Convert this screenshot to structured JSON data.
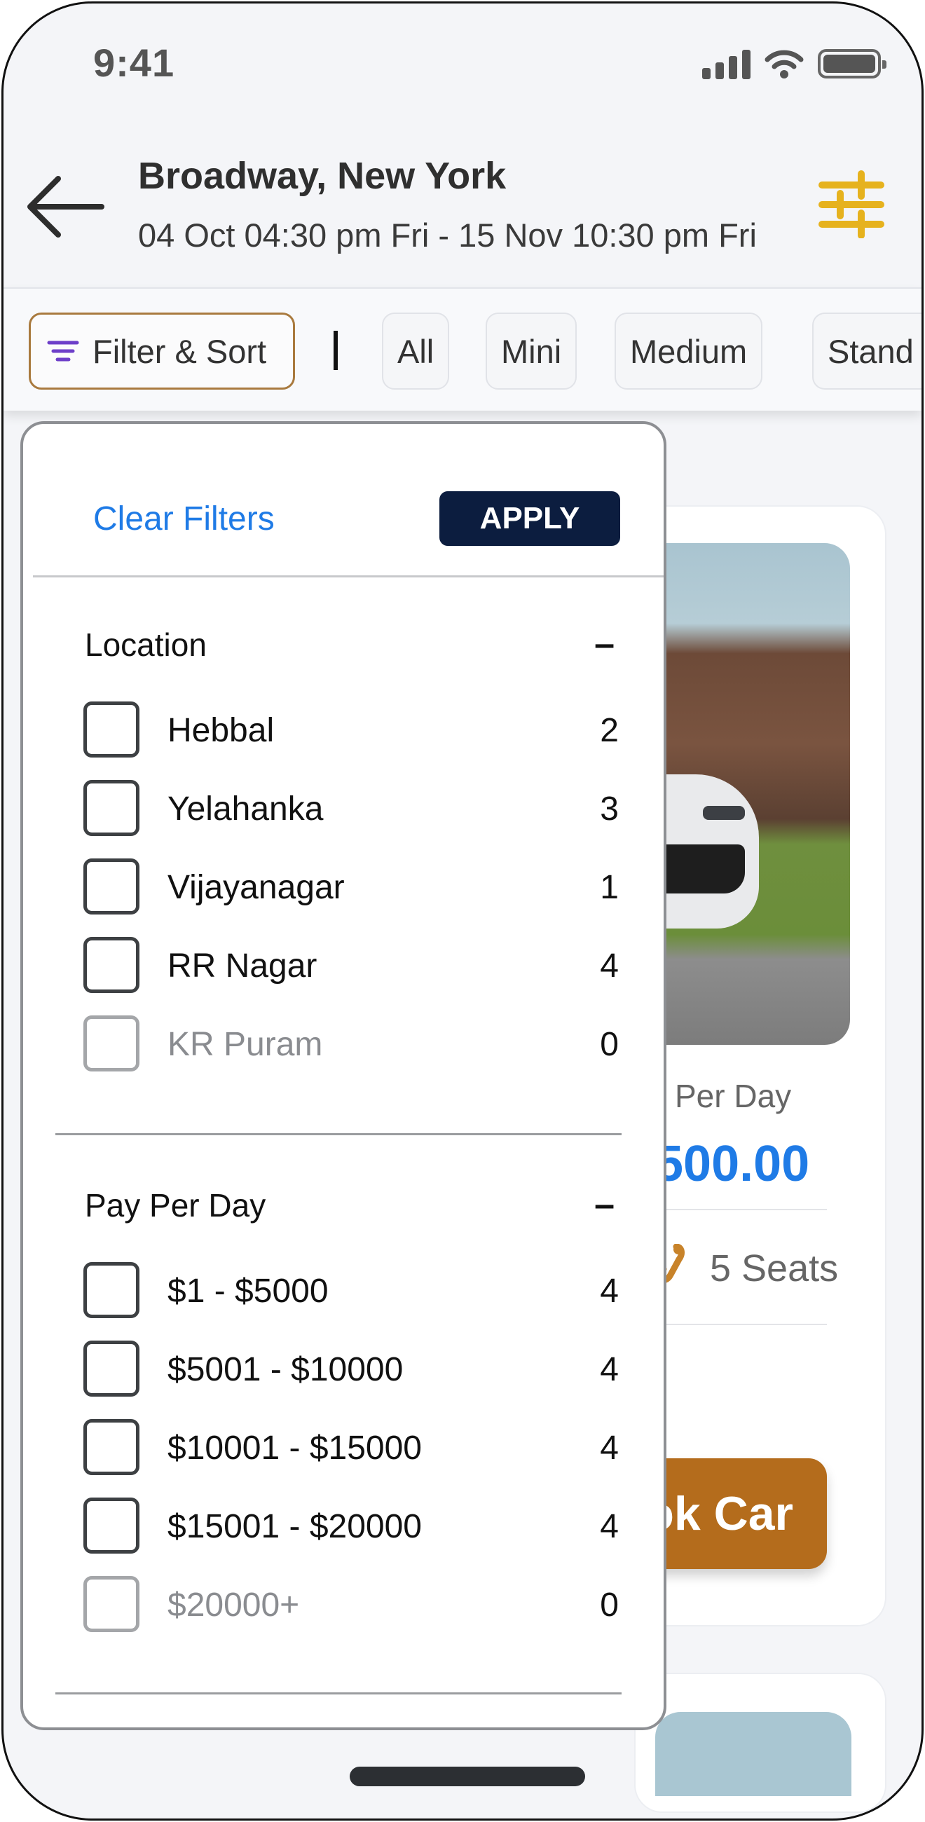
{
  "status_bar": {
    "time": "9:41"
  },
  "header": {
    "location": "Broadway, New York",
    "dates": "04 Oct 04:30 pm Fri - 15 Nov 10:30 pm Fri"
  },
  "chips": {
    "filter_label": "Filter & Sort",
    "categories": [
      "All",
      "Mini",
      "Medium",
      "Stand"
    ]
  },
  "car_card": {
    "per_day": "Per Day",
    "price": "500.00",
    "seats": "5 Seats",
    "book_label": "ok Car"
  },
  "filter_panel": {
    "clear_label": "Clear Filters",
    "apply_label": "APPLY",
    "sections": [
      {
        "title": "Location",
        "toggle": "–",
        "options": [
          {
            "label": "Hebbal",
            "count": "2",
            "enabled": true
          },
          {
            "label": "Yelahanka",
            "count": "3",
            "enabled": true
          },
          {
            "label": "Vijayanagar",
            "count": "1",
            "enabled": true
          },
          {
            "label": "RR Nagar",
            "count": "4",
            "enabled": true
          },
          {
            "label": "KR Puram",
            "count": "0",
            "enabled": false
          }
        ]
      },
      {
        "title": "Pay Per Day",
        "toggle": "–",
        "options": [
          {
            "label": "$1 - $5000",
            "count": "4",
            "enabled": true
          },
          {
            "label": "$5001 - $10000",
            "count": "4",
            "enabled": true
          },
          {
            "label": "$10001 - $15000",
            "count": "4",
            "enabled": true
          },
          {
            "label": "$15001 - $20000",
            "count": "4",
            "enabled": true
          },
          {
            "label": "$20000+",
            "count": "0",
            "enabled": false
          }
        ]
      }
    ]
  },
  "colors": {
    "accent_blue": "#1f7be6",
    "brand_brown": "#b46c1c",
    "apply_navy": "#0c1d3f",
    "settings_yellow": "#e6b21e",
    "filter_icon_purple": "#6d3fc9"
  },
  "icons": [
    "back-arrow-icon",
    "settings-sliders-icon",
    "filter-lines-icon",
    "seat-icon",
    "signal-icon",
    "wifi-icon",
    "battery-icon"
  ]
}
